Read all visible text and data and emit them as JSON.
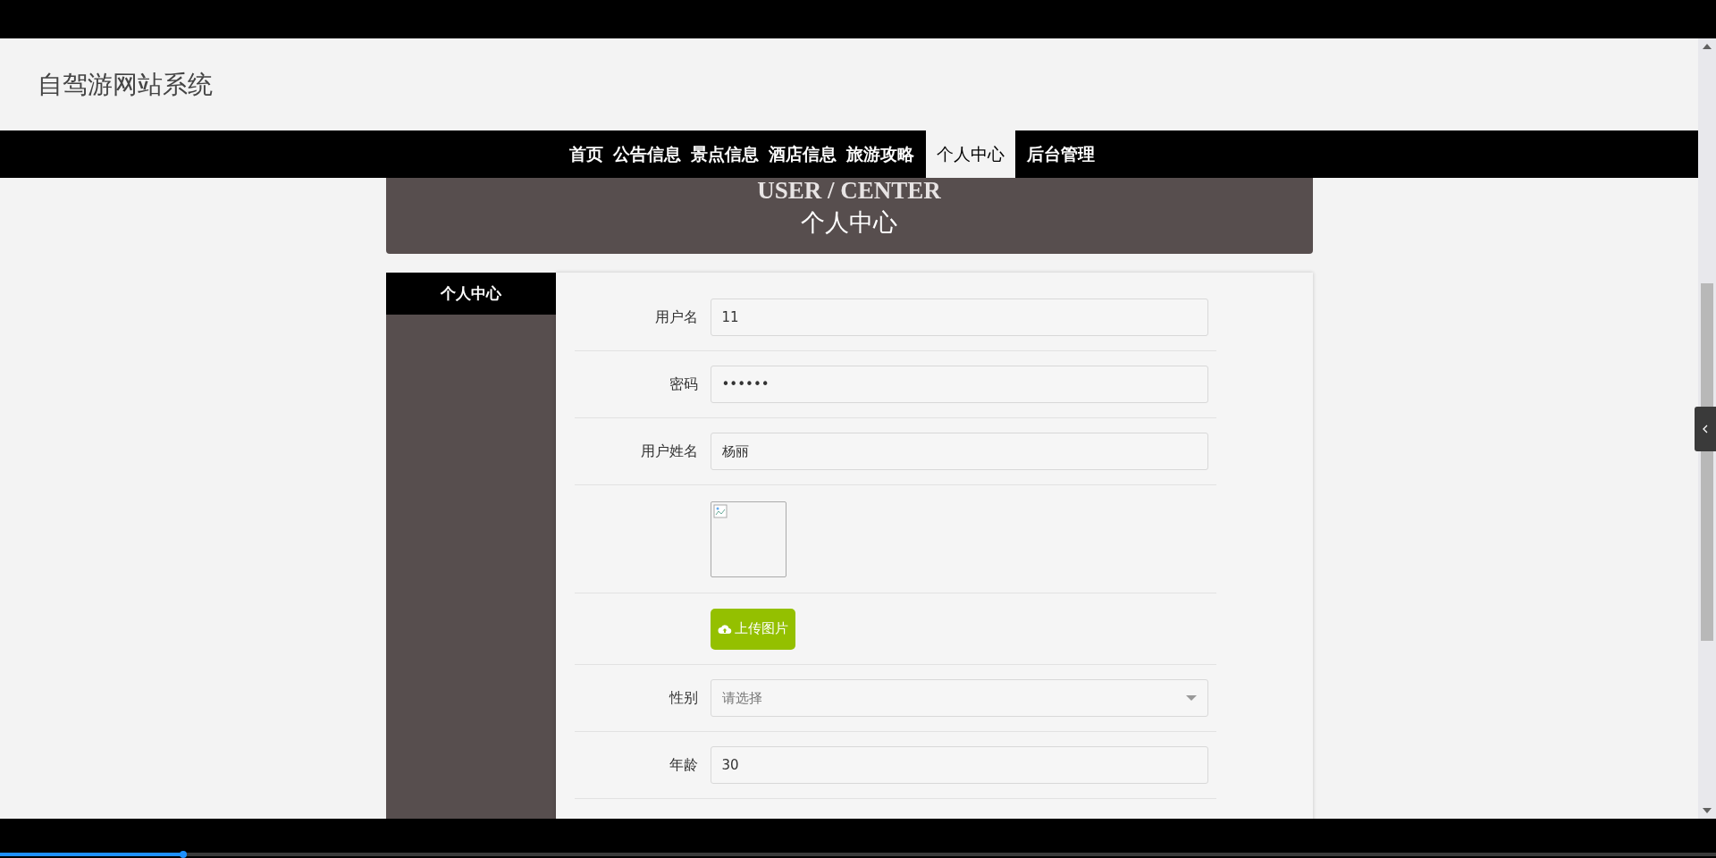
{
  "site_title": "自驾游网站系统",
  "nav": [
    {
      "label": "首页",
      "selected": false
    },
    {
      "label": "公告信息",
      "selected": false
    },
    {
      "label": "景点信息",
      "selected": false
    },
    {
      "label": "酒店信息",
      "selected": false
    },
    {
      "label": "旅游攻略",
      "selected": false
    },
    {
      "label": "个人中心",
      "selected": true
    },
    {
      "label": "后台管理",
      "selected": false
    }
  ],
  "banner": {
    "title_en": "USER / CENTER",
    "title": "个人中心"
  },
  "sidebar": {
    "items": [
      {
        "label": "个人中心",
        "selected": true
      }
    ]
  },
  "form": {
    "rows": [
      {
        "kind": "text",
        "label": "用户名",
        "value": "11"
      },
      {
        "kind": "text",
        "label": "密码",
        "value": "••••••"
      },
      {
        "kind": "text",
        "label": "用户姓名",
        "value": "杨丽"
      },
      {
        "kind": "image"
      },
      {
        "kind": "upload",
        "button": "上传图片"
      },
      {
        "kind": "select",
        "label": "性别",
        "placeholder": "请选择"
      },
      {
        "kind": "text",
        "label": "年龄",
        "value": "30"
      }
    ]
  },
  "player": {
    "level": 0.107
  }
}
